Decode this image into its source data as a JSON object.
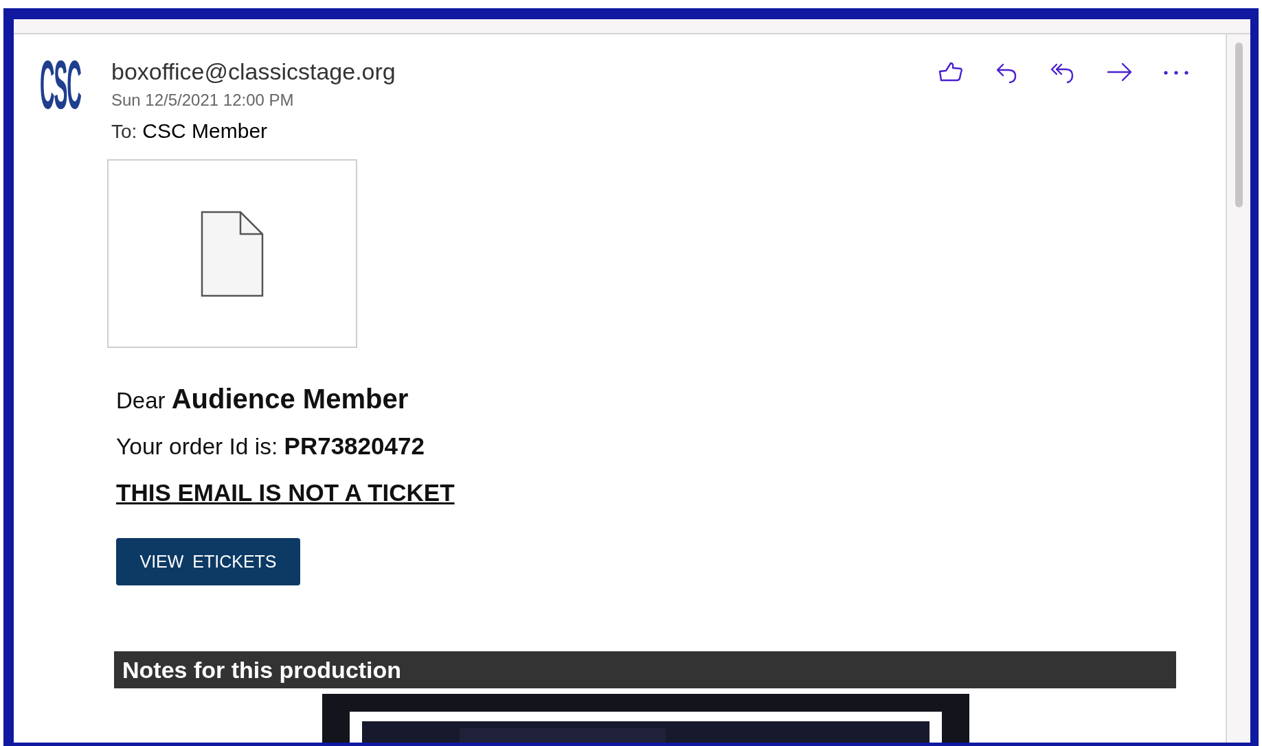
{
  "logo": {
    "text": "CSC"
  },
  "message": {
    "sender": "boxoffice@classicstage.org",
    "date": "Sun 12/5/2021 12:00 PM",
    "to_label": "To:",
    "to": "CSC Member"
  },
  "toolbar": [
    {
      "kind": "like"
    },
    {
      "kind": "reply"
    },
    {
      "kind": "reply_all"
    },
    {
      "kind": "forward"
    },
    {
      "kind": "more"
    }
  ],
  "body": {
    "greeting": "Dear **Audience Member**",
    "order": "Your order Id is: **PR73820472**",
    "notice": "THIS EMAIL IS NOT A TICKET",
    "button": "VIEW ETICKETS",
    "section_title": "Notes for this production"
  }
}
